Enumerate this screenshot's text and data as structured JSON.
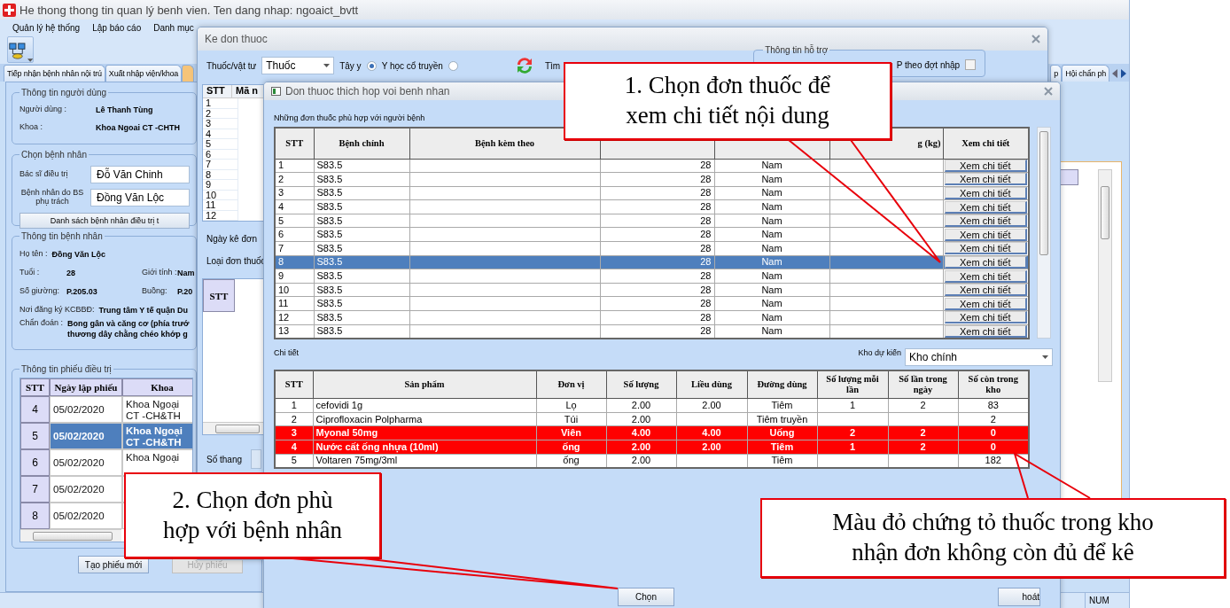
{
  "app": {
    "title": "He thong thong tin quan lý benh vien. Ten dang nhap: ngoaict_bvtt",
    "menu": [
      "Quản lý hệ thống",
      "Lập báo cáo",
      "Danh mục"
    ],
    "status": "NUM"
  },
  "tabs": [
    {
      "label": "Tiếp nhận bệnh nhân nội trú",
      "selected": false
    },
    {
      "label": "Xuất nhập viện/khoa",
      "selected": false
    },
    {
      "selected": true
    }
  ],
  "right_tabs": [
    {
      "label": "p",
      "selected": false
    },
    {
      "label": "Hội chẩn ph",
      "selected": false
    }
  ],
  "user_info": {
    "title": "Thông tin người dùng",
    "fields": [
      {
        "label": "Người dùng :",
        "value": "Lê Thanh Tùng"
      },
      {
        "label": "Khoa :",
        "value": "Khoa Ngoai CT -CHTH"
      }
    ]
  },
  "patient_select": {
    "title": "Chọn bệnh nhân",
    "fields": [
      {
        "label": "Bác sĩ điều trị",
        "value": "Đỗ Văn Chinh"
      },
      {
        "label": "Bệnh nhân do BS phụ trách",
        "value": "Đồng Văn Lộc"
      }
    ],
    "button": "Danh sách bệnh nhân điều trị t"
  },
  "patient_info": {
    "title": "Thông tin bệnh nhân",
    "lines": [
      [
        {
          "label": "Họ tên :",
          "value": "Đồng Văn Lộc"
        }
      ],
      [
        {
          "label": "Tuổi :",
          "value": "28"
        },
        {
          "label": "Giới tính :",
          "value": "Nam"
        }
      ],
      [
        {
          "label": "Số giường:",
          "value": "P.205.03"
        },
        {
          "label": "Buồng:",
          "value": "P.20"
        }
      ],
      [
        {
          "label": "Nơi đăng ký KCBBĐ:",
          "value": "Trung tâm Y tế quận Du"
        }
      ],
      [
        {
          "label": "Chẩn đoán :",
          "value_lines": [
            "Bong gân và căng cơ (phía trướ",
            "thương dây chằng chéo khớp g"
          ]
        }
      ]
    ]
  },
  "treatment": {
    "title": "Thông tin phiếu điều trị",
    "columns": [
      "STT",
      "Ngày lập phiếu",
      "Khoa"
    ],
    "rows": [
      {
        "stt": "4",
        "date": "05/02/2020",
        "dept": [
          "Khoa Ngoại",
          "CT -CH&TH"
        ],
        "selected": false
      },
      {
        "stt": "5",
        "date": "05/02/2020",
        "dept": [
          "Khoa Ngoại",
          "CT -CH&TH"
        ],
        "selected": true
      },
      {
        "stt": "6",
        "date": "05/02/2020",
        "dept": [
          "Khoa Ngoại"
        ],
        "selected": false
      },
      {
        "stt": "7",
        "date": "05/02/2020",
        "selected": false
      },
      {
        "stt": "8",
        "date": "05/02/2020",
        "selected": false
      }
    ],
    "buttons": [
      {
        "label": "Tạo phiếu mới",
        "disabled": false
      },
      {
        "label": "Hủy phiếu",
        "disabled": true
      }
    ]
  },
  "prescribe": {
    "title": "Ke don thuoc",
    "type_label": "Thuốc/vật tư",
    "type_value": "Thuốc",
    "options": [
      {
        "label": "Tây y",
        "selected": true
      },
      {
        "label": "Y học cổ truyền",
        "selected": false
      }
    ],
    "search_label": "Tìm",
    "support": {
      "title": "Thông tin hỗ trợ",
      "label": "P theo đợt nhập",
      "checked": false
    },
    "list_columns": [
      "STT",
      "Mã n"
    ],
    "list_rows": [
      "1",
      "2",
      "3",
      "4",
      "5",
      "6",
      "7",
      "8",
      "9",
      "10",
      "11",
      "12"
    ],
    "date_label": "Ngày kê đơn",
    "kind_label": "Loại đơn thuốc",
    "grid_column": "STT",
    "packs_label": "Số thang"
  },
  "dialog": {
    "title": "Don thuoc thich hop voi benh nhan",
    "caption": "Những đơn thuốc phù hợp với người bệnh",
    "columns": [
      {
        "label": "STT"
      },
      {
        "label": "Bệnh chính"
      },
      {
        "label": "Bệnh kèm theo"
      },
      {},
      {},
      {
        "label": "g (kg)"
      },
      {
        "label": "Xem chi tiết"
      }
    ],
    "rows": [
      {
        "stt": "1",
        "main": "S83.5",
        "age": "28",
        "sex": "Nam",
        "action": "Xem chi tiết",
        "selected": false
      },
      {
        "stt": "2",
        "main": "S83.5",
        "age": "28",
        "sex": "Nam",
        "action": "Xem chi tiết",
        "selected": false
      },
      {
        "stt": "3",
        "main": "S83.5",
        "age": "28",
        "sex": "Nam",
        "action": "Xem chi tiết",
        "selected": false
      },
      {
        "stt": "4",
        "main": "S83.5",
        "age": "28",
        "sex": "Nam",
        "action": "Xem chi tiết",
        "selected": false
      },
      {
        "stt": "5",
        "main": "S83.5",
        "age": "28",
        "sex": "Nam",
        "action": "Xem chi tiết",
        "selected": false
      },
      {
        "stt": "6",
        "main": "S83.5",
        "age": "28",
        "sex": "Nam",
        "action": "Xem chi tiết",
        "selected": false
      },
      {
        "stt": "7",
        "main": "S83.5",
        "age": "28",
        "sex": "Nam",
        "action": "Xem chi tiết",
        "selected": false
      },
      {
        "stt": "8",
        "main": "S83.5",
        "age": "28",
        "sex": "Nam",
        "action": "Xem chi tiết",
        "selected": true
      },
      {
        "stt": "9",
        "main": "S83.5",
        "age": "28",
        "sex": "Nam",
        "action": "Xem chi tiết",
        "selected": false
      },
      {
        "stt": "10",
        "main": "S83.5",
        "age": "28",
        "sex": "Nam",
        "action": "Xem chi tiết",
        "selected": false
      },
      {
        "stt": "11",
        "main": "S83.5",
        "age": "28",
        "sex": "Nam",
        "action": "Xem chi tiết",
        "selected": false
      },
      {
        "stt": "12",
        "main": "S83.5",
        "age": "28",
        "sex": "Nam",
        "action": "Xem chi tiết",
        "selected": false
      },
      {
        "stt": "13",
        "main": "S83.5",
        "age": "28",
        "sex": "Nam",
        "action": "Xem chi tiết",
        "selected": false
      }
    ],
    "detail_caption": "Chi tiết",
    "warehouse_label": "Kho dự kiến",
    "warehouse": "Kho chính",
    "detail_columns": [
      "STT",
      "Sản phẩm",
      "Đơn vị",
      "Số lượng",
      "Liều dùng",
      "Đường dùng",
      "Số lượng mỗi lần",
      "Số lần trong ngày",
      "Số còn trong kho"
    ],
    "detail_rows": [
      {
        "stt": "1",
        "product": "cefovidi 1g",
        "unit": "Lọ",
        "qty": "2.00",
        "dose": "2.00",
        "route": "Tiêm",
        "per_time": "1",
        "per_day": "2",
        "stock": "83",
        "insufficient": false
      },
      {
        "stt": "2",
        "product": "Ciprofloxacin  Polpharma",
        "unit": "Túi",
        "qty": "2.00",
        "route": "Tiêm truyền",
        "stock": "2",
        "insufficient": false
      },
      {
        "stt": "3",
        "product": "Myonal 50mg",
        "unit": "Viên",
        "qty": "4.00",
        "dose": "4.00",
        "route": "Uống",
        "per_time": "2",
        "per_day": "2",
        "stock": "0",
        "insufficient": true
      },
      {
        "stt": "4",
        "product": "Nước cất ống nhựa (10ml)",
        "unit": "ống",
        "qty": "2.00",
        "dose": "2.00",
        "route": "Tiêm",
        "per_time": "1",
        "per_day": "2",
        "stock": "0",
        "insufficient": true
      },
      {
        "stt": "5",
        "product": "Voltaren 75mg/3ml",
        "unit": "ống",
        "qty": "2.00",
        "route": "Tiêm",
        "stock": "182",
        "insufficient": false
      }
    ],
    "buttons": [
      "Chọn",
      "hoát"
    ]
  },
  "callouts": [
    {
      "lines": [
        "1. Chọn đơn thuốc để",
        "xem chi tiết nội dung"
      ]
    },
    {
      "lines": [
        "2. Chọn đơn phù",
        "hợp với bệnh nhân"
      ]
    },
    {
      "lines": [
        "Màu đỏ chứng tỏ thuốc trong kho",
        "nhận đơn không còn đủ để kê"
      ]
    }
  ]
}
